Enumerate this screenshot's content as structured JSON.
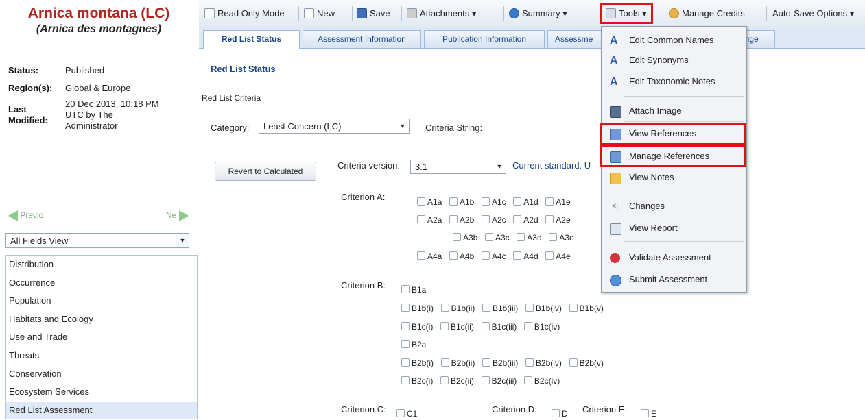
{
  "species": {
    "title": "Arnica montana (LC)",
    "common": "(Arnica des montagnes)"
  },
  "meta": {
    "status_label": "Status:",
    "status_value": "Published",
    "region_label": "Region(s):",
    "region_value": "Global & Europe",
    "modified_label_1": "Last",
    "modified_label_2": "Modified:",
    "modified_line_1": "20 Dec 2013, 10:18 PM",
    "modified_line_2": "UTC by The",
    "modified_line_3": "Administrator"
  },
  "nav": {
    "prev": "Previo",
    "next": "Ne",
    "view_select": "All Fields View",
    "items": [
      "Distribution",
      "Occurrence",
      "Population",
      "Habitats and Ecology",
      "Use and Trade",
      "Threats",
      "Conservation",
      "Ecosystem Services",
      "Red List Assessment"
    ],
    "selected": "Red List Assessment"
  },
  "toolbar": {
    "read_only": "Read Only Mode",
    "new": "New",
    "save": "Save",
    "attachments": "Attachments",
    "summary": "Summary",
    "tools": "Tools",
    "manage_credits": "Manage Credits",
    "auto_save": "Auto-Save Options"
  },
  "tabs": [
    "Red List Status",
    "Assessment Information",
    "Publication Information",
    "Assessme",
    "ange"
  ],
  "main": {
    "panel_title": "Red List Status",
    "criteria_header": "Red List Criteria",
    "category_label": "Category:",
    "category_value": "Least Concern (LC)",
    "criteria_string_label": "Criteria String:",
    "revert_button": "Revert to Calculated",
    "criteria_version_label": "Criteria version:",
    "criteria_version_value": "3.1",
    "current_standard_note": "Current standard. U",
    "criterion_a_label": "Criterion A:",
    "criterion_b_label": "Criterion B:",
    "criterion_c_label": "Criterion C:",
    "criterion_d_label": "Criterion D:",
    "criterion_e_label": "Criterion E:",
    "a_rows": [
      [
        "A1a",
        "A1b",
        "A1c",
        "A1d",
        "A1e"
      ],
      [
        "A2a",
        "A2b",
        "A2c",
        "A2d",
        "A2e"
      ],
      [
        "A3b",
        "A3c",
        "A3d",
        "A3e"
      ],
      [
        "A4a",
        "A4b",
        "A4c",
        "A4d",
        "A4e"
      ]
    ],
    "b_rows": [
      [
        "B1a"
      ],
      [
        "B1b(i)",
        "B1b(ii)",
        "B1b(iii)",
        "B1b(iv)",
        "B1b(v)"
      ],
      [
        "B1c(i)",
        "B1c(ii)",
        "B1c(iii)",
        "B1c(iv)"
      ],
      [
        "B2a"
      ],
      [
        "B2b(i)",
        "B2b(ii)",
        "B2b(iii)",
        "B2b(iv)",
        "B2b(v)"
      ],
      [
        "B2c(i)",
        "B2c(ii)",
        "B2c(iii)",
        "B2c(iv)"
      ]
    ],
    "c_item": "C1",
    "d_item": "D",
    "e_item": "E"
  },
  "tools_menu": {
    "items": [
      {
        "label": "Edit Common Names",
        "icon": "font-a-icon"
      },
      {
        "label": "Edit Synonyms",
        "icon": "font-a-icon"
      },
      {
        "label": "Edit Taxonomic Notes",
        "icon": "font-a-icon"
      },
      {
        "label": "Attach Image",
        "icon": "image-icon"
      },
      {
        "label": "View References",
        "icon": "book-icon"
      },
      {
        "label": "Manage References",
        "icon": "edit-book-icon"
      },
      {
        "label": "View Notes",
        "icon": "note-icon"
      },
      {
        "label": "Changes",
        "icon": "history-icon"
      },
      {
        "label": "View Report",
        "icon": "report-icon"
      },
      {
        "label": "Validate Assessment",
        "icon": "ribbon-icon"
      },
      {
        "label": "Submit Assessment",
        "icon": "globe-icon"
      }
    ]
  },
  "colors": {
    "species_title": "#b3261e",
    "highlight": "#e0101a",
    "link_blue": "#15428b"
  }
}
